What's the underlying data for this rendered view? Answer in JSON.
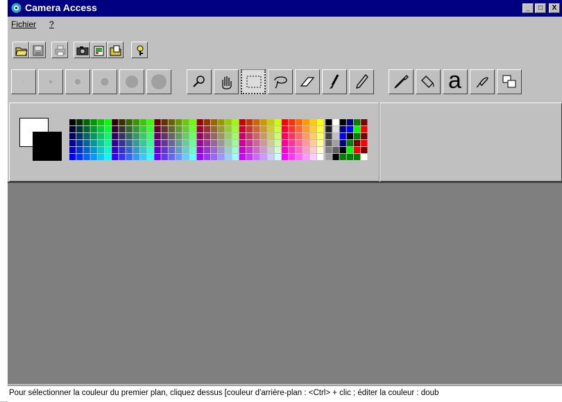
{
  "window": {
    "title": "Camera Access",
    "controls": {
      "minimize": "_",
      "maximize": "□",
      "close": "X"
    }
  },
  "menu": {
    "items": [
      "Fichier",
      "?"
    ]
  },
  "toolbar_file": {
    "icons": [
      "open-folder-icon",
      "save-icon",
      "print-icon",
      "camera-icon",
      "import-icon",
      "open-file-icon",
      "help-icon"
    ]
  },
  "toolbar_tools": {
    "brush_sizes": [
      1,
      3,
      5,
      7,
      10,
      12
    ],
    "tools": [
      "zoom-icon",
      "hand-icon",
      "select-rectangle-icon",
      "lasso-icon",
      "eraser-icon",
      "brush-icon",
      "pencil-icon",
      "color-picker-icon",
      "fill-bucket-icon",
      "text-icon",
      "smudge-icon",
      "clone-icon"
    ],
    "text_tool_glyph": "a",
    "active_tool": "select-rectangle-icon"
  },
  "colors": {
    "foreground": "#000000",
    "background": "#ffffff",
    "canvas": "#7f7f7f",
    "titlebar": "#000080"
  },
  "status": {
    "text": "Pour sélectionner la couleur du premier plan, cliquez dessus [couleur d'arrière-plan : <Ctrl> + clic ; éditer la couleur : doub"
  }
}
